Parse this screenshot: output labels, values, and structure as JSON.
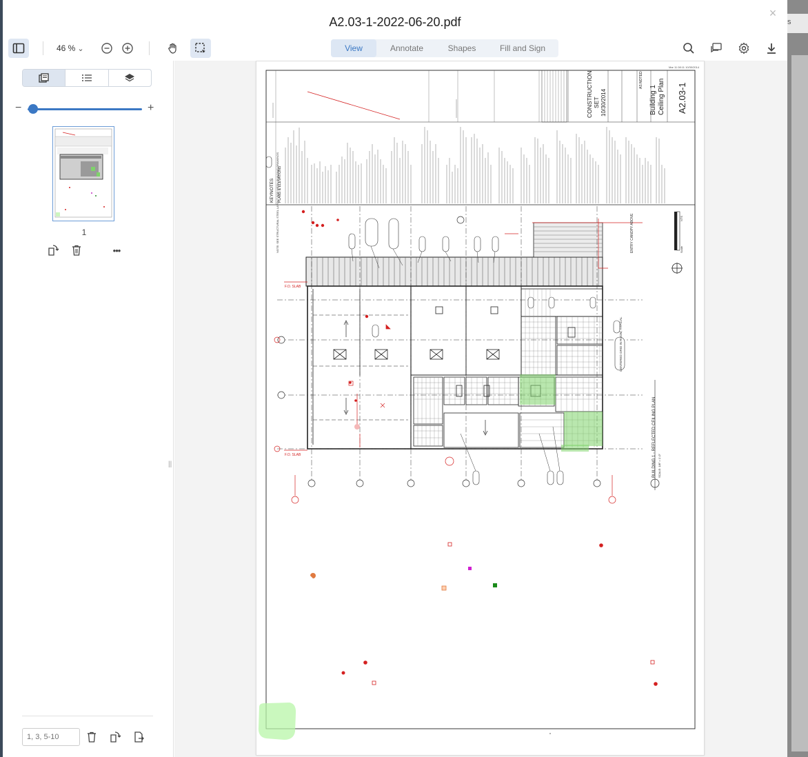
{
  "title": "A2.03-1-2022-06-20.pdf",
  "close_label": "×",
  "backdrop_right_text": "s",
  "toolbar": {
    "zoom_value": "46 %",
    "zoom_caret": "⌄"
  },
  "mode_tabs": [
    "View",
    "Annotate",
    "Shapes",
    "Fill and Sign"
  ],
  "sidebar": {
    "slider_minus": "−",
    "slider_plus": "+",
    "thumbnail_slider_fraction": 0.05,
    "page_number": "1",
    "more_label": "•••",
    "page_range_placeholder": "1, 3, 5-10",
    "split_handle": "||"
  },
  "drawing": {
    "sheet_number": "A2.03-1",
    "sheet_title_1": "Building 1",
    "sheet_title_2": "Ceiling Plan",
    "set_line_1": "CONSTRUCTION",
    "set_line_2": "SET",
    "set_date": "10/30/2014",
    "as_noted": "AS NOTED",
    "keynotes_title": "KEYNOTES",
    "keynotes_subtitle": "PLANS & ELEVATIONS",
    "plan_title": "BUILDING 1 - REFLECTED CEILING PLAN",
    "plan_scale": "SCALE: 1/8\" = 1'-0\"",
    "scale_label": "Scale",
    "north_label": "NTS",
    "entry_canopy": "ENTRY CANOPY ABOVE",
    "centered_grid": "CENTERED GRID IN ROOM, TYPICAL",
    "fo_slab": "F.O. SLAB",
    "notes_vertical": "NOTE: SEE STRUCTURAL STEEL LAYOUT FOR METAL BUILDING DRAWINGS"
  },
  "colors": {
    "accent": "#3b78c4",
    "markup_red": "#d42020",
    "highlight_green": "#7fd36b",
    "tab_selected_bg": "#dde7f4",
    "page_bg": "#f3f3f3"
  }
}
